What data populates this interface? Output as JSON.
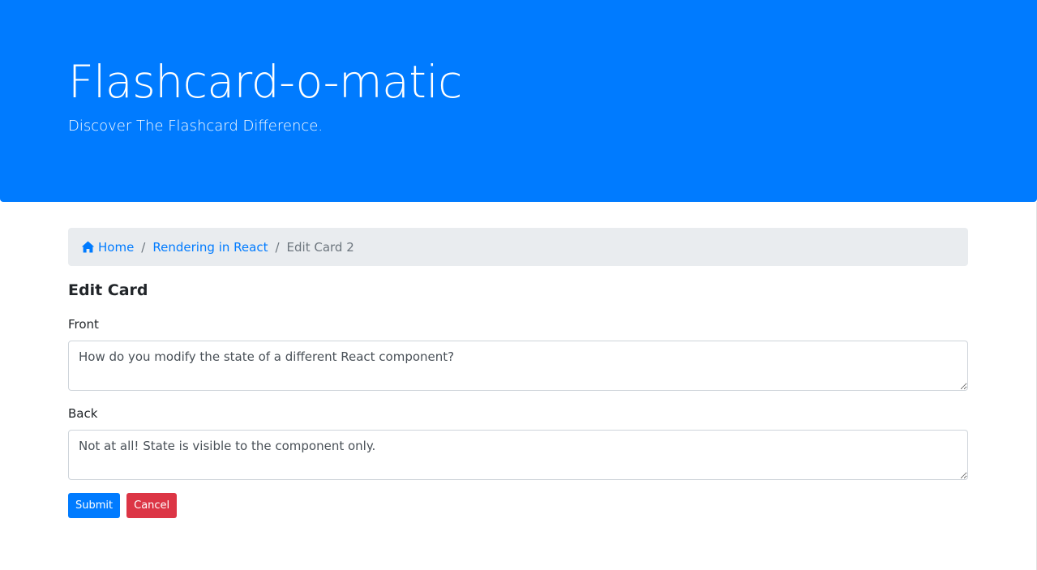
{
  "header": {
    "title": "Flashcard-o-matic",
    "subtitle": "Discover The Flashcard Difference."
  },
  "breadcrumb": {
    "home_icon": "home-icon",
    "home_label": "Home",
    "deck_label": "Rendering in React",
    "separator": "/",
    "current_label": "Edit Card 2"
  },
  "form": {
    "title": "Edit Card",
    "front_label": "Front",
    "front_value": "How do you modify the state of a different React component?",
    "back_label": "Back",
    "back_value": "Not at all! State is visible to the component only.",
    "submit_label": "Submit",
    "cancel_label": "Cancel"
  },
  "colors": {
    "primary": "#007bff",
    "danger": "#dc3545",
    "breadcrumb_bg": "#e9ecef"
  }
}
